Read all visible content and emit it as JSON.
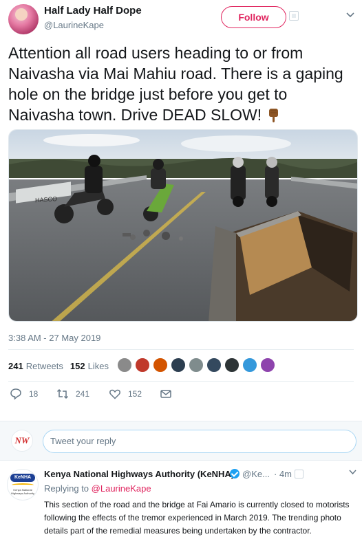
{
  "tweet": {
    "author": {
      "display_name": "Half Lady Half Dope",
      "handle": "@LaurineKape"
    },
    "follow_label": "Follow",
    "text": "Attention all road users heading to or from Naivasha via Mai Mahiu road. There is a gaping hole on the bridge just before you get to Naivasha town. Drive DEAD SLOW!",
    "emoji_icon": "pointing-down-hand-icon",
    "photo_sign_text": "HASCO",
    "timestamp": "3:38 AM - 27 May 2019",
    "stats": {
      "retweets_count": "241",
      "retweets_label": "Retweets",
      "likes_count": "152",
      "likes_label": "Likes"
    },
    "liker_colors": [
      "#8a8a8a",
      "#c0392b",
      "#d35400",
      "#2c3e50",
      "#7f8c8d",
      "#34495e",
      "#2d3436",
      "#3498db",
      "#8e44ad"
    ],
    "actions": {
      "reply_count": "18",
      "retweet_count": "241",
      "like_count": "152"
    }
  },
  "reply_box": {
    "avatar_text": "NW",
    "placeholder": "Tweet your reply"
  },
  "reply": {
    "author": {
      "display_name": "Kenya National Highways Authority (KeNHA)",
      "handle": "@Ke...",
      "logo_text": "KeNHA",
      "logo_caption": "Kenya National Highways Authority"
    },
    "time": "· 4m",
    "replying_prefix": "Replying to",
    "replying_handle": "@LaurineKape",
    "text": "This section of the road and the bridge at Fai Amario  is currently closed to motorists following the effects of the tremor experienced in March 2019. The trending photo details part of the remedial measures being undertaken by the contractor."
  },
  "colors": {
    "accent": "#e0245e",
    "secondary_text": "#657786",
    "verified": "#1da1f2"
  }
}
